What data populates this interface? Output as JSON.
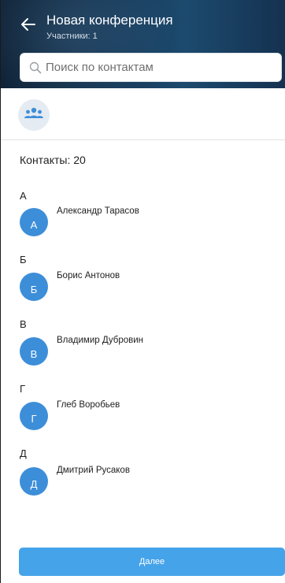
{
  "header": {
    "title": "Новая конференция",
    "subtitle": "Участники: 1",
    "back_icon": "arrow-left-icon"
  },
  "search": {
    "placeholder": "Поиск по контактам",
    "value": "",
    "icon": "search-icon"
  },
  "group_button": {
    "icon": "group-icon"
  },
  "contacts": {
    "count_label": "Контакты: 20",
    "sections": [
      {
        "letter": "А",
        "items": [
          {
            "initial": "А",
            "name": "Александр Тарасов"
          }
        ]
      },
      {
        "letter": "Б",
        "items": [
          {
            "initial": "Б",
            "name": "Борис Антонов"
          }
        ]
      },
      {
        "letter": "В",
        "items": [
          {
            "initial": "В",
            "name": "Владимир Дубровин"
          }
        ]
      },
      {
        "letter": "Г",
        "items": [
          {
            "initial": "Г",
            "name": "Глеб Воробьев"
          }
        ]
      },
      {
        "letter": "Д",
        "items": [
          {
            "initial": "Д",
            "name": "Дмитрий Русаков"
          }
        ]
      }
    ]
  },
  "footer": {
    "next_label": "Далее"
  },
  "colors": {
    "header_dark": "#163654",
    "accent": "#45a3e9",
    "avatar": "#3d8ed8",
    "group_bg": "#e5ebf2"
  }
}
